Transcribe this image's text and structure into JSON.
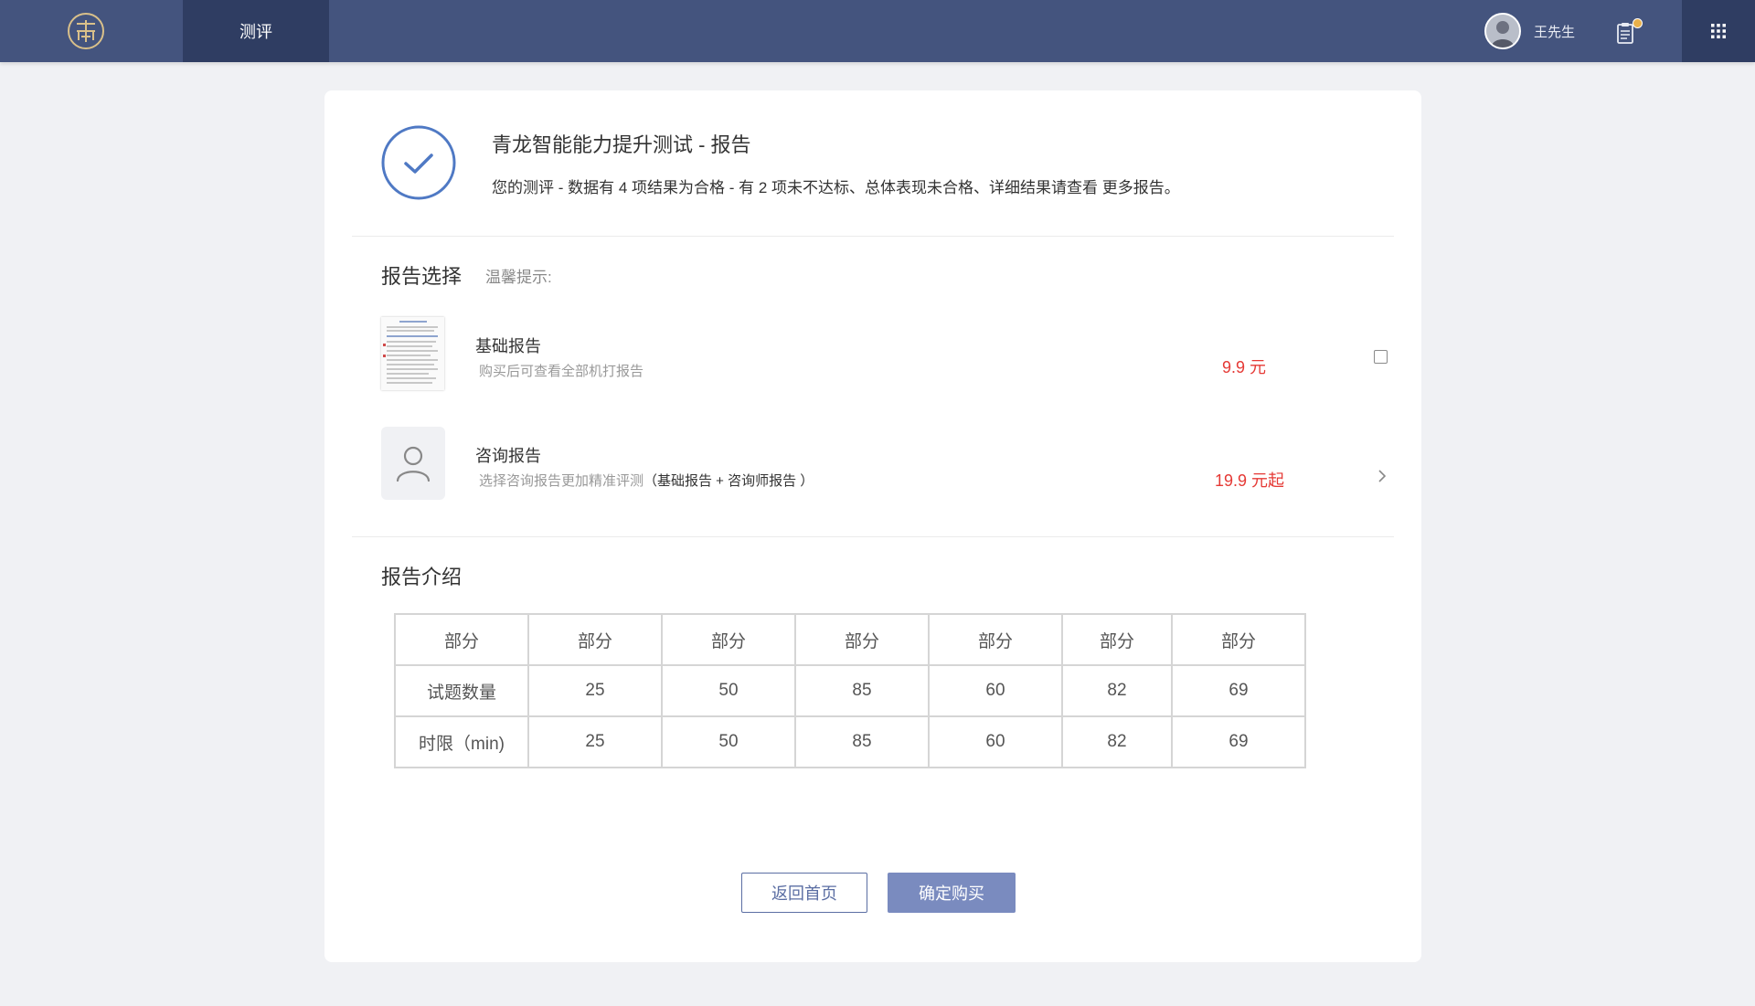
{
  "nav": {
    "tab_label": "测评"
  },
  "user": {
    "name": "王先生"
  },
  "colors": {
    "topbar": "#44547e",
    "nav_active": "#2f3d62",
    "price": "#e53935",
    "primary_button": "#7a8bbf",
    "check_circle": "#4f79c4"
  },
  "icons": {
    "logo": "logo-icon",
    "avatar": "avatar-icon",
    "clipboard": "clipboard-icon",
    "apps": "apps-grid-icon",
    "check": "check-circle-icon",
    "consult": "user-icon",
    "chevron": "chevron-right-icon"
  },
  "result": {
    "title": "青龙智能能力提升测试 - 报告",
    "description": "您的测评 - 数据有 4 项结果为合格 - 有 2 项未不达标、总体表现未合格、详细结果请查看 更多报告。"
  },
  "report_select": {
    "title": "报告选择",
    "tip": "温馨提示:",
    "items": [
      {
        "name": "基础报告",
        "desc": "购买后可查看全部机打报告",
        "price": "9.9 元",
        "checked": false
      },
      {
        "name": "咨询报告",
        "desc": "选择咨询报告更加精准评测",
        "desc_detail": "（基础报告 + 咨询师报告 ）",
        "price": "19.9 元起"
      }
    ]
  },
  "intro": {
    "title": "报告介绍",
    "table": {
      "header": [
        "部分",
        "部分",
        "部分",
        "部分",
        "部分",
        "部分",
        "部分"
      ],
      "rows": [
        [
          "试题数量",
          "25",
          "50",
          "85",
          "60",
          "82",
          "69"
        ],
        [
          "时限（min)",
          "25",
          "50",
          "85",
          "60",
          "82",
          "69"
        ]
      ]
    }
  },
  "buttons": {
    "back": "返回首页",
    "buy": "确定购买"
  }
}
